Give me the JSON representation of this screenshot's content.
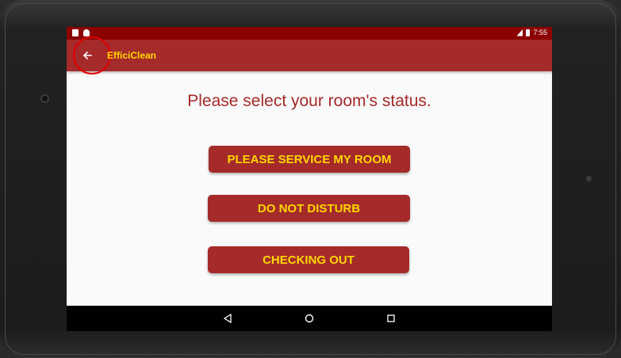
{
  "status_bar": {
    "time": "7:55",
    "left_icons": [
      "notification-icon",
      "android-icon"
    ],
    "right_icons": [
      "signal-icon",
      "battery-icon"
    ]
  },
  "app_bar": {
    "title": "EfficiClean",
    "back_icon": "arrow-back-icon",
    "color": "#a52a2a",
    "title_color": "#ffd700"
  },
  "main": {
    "prompt": "Please select your room's status.",
    "buttons": [
      {
        "label": "PLEASE SERVICE MY ROOM"
      },
      {
        "label": "DO NOT DISTURB"
      },
      {
        "label": "CHECKING OUT"
      }
    ],
    "accent": "#a52a2a",
    "button_text_color": "#ffd700"
  },
  "nav_bar": {
    "icons": [
      "back-triangle-icon",
      "home-circle-icon",
      "recents-square-icon"
    ]
  }
}
